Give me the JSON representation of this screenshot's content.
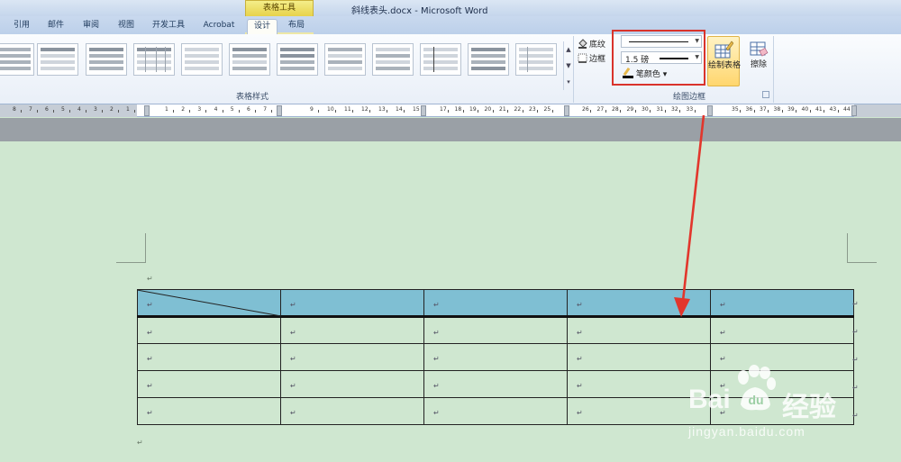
{
  "window": {
    "title": "斜线表头.docx  -  Microsoft Word"
  },
  "context_tab": {
    "header": "表格工具"
  },
  "tabs": [
    {
      "label": "引用"
    },
    {
      "label": "邮件"
    },
    {
      "label": "审阅"
    },
    {
      "label": "视图"
    },
    {
      "label": "开发工具"
    },
    {
      "label": "Acrobat"
    },
    {
      "label": "设计"
    },
    {
      "label": "布局"
    }
  ],
  "ribbon": {
    "table_styles_group": "表格样式",
    "shading": "底纹",
    "borders": "边框",
    "line_weight": "1.5 磅",
    "pen_color": "笔颜色",
    "draw_table": "绘制表格",
    "eraser": "擦除",
    "draw_borders_group": "绘图边框"
  },
  "ruler": {
    "left_numbers": [
      "8",
      "7",
      "6",
      "5",
      "4",
      "3",
      "2",
      "1"
    ],
    "right_numbers": [
      "2",
      "4",
      "6",
      "8",
      "10",
      "12",
      "14",
      "16",
      "18",
      "20",
      "22",
      "24",
      "26",
      "28",
      "30",
      "32",
      "34",
      "36",
      "38",
      "40",
      "42",
      "44"
    ],
    "mid_numbers": [
      "1",
      "2",
      "3",
      "4",
      "5",
      "6",
      "7",
      "9",
      "10",
      "11",
      "12",
      "13",
      "14",
      "15",
      "17",
      "18",
      "19",
      "20",
      "21",
      "22",
      "23",
      "25",
      "26",
      "27",
      "28",
      "29",
      "30",
      "31",
      "32",
      "33",
      "35",
      "36",
      "37",
      "38",
      "39",
      "40",
      "41",
      "43",
      "44"
    ]
  },
  "document": {
    "para_mark": "↵",
    "table": {
      "rows": 5,
      "cols": 5
    }
  },
  "watermark": {
    "brand": "Bai",
    "brand2": "经验",
    "url": "jingyan.baidu.com"
  },
  "colors": {
    "header_fill": "#7fbfd3",
    "highlight": "#d9332b",
    "page_bg": "#cfe7d0"
  }
}
